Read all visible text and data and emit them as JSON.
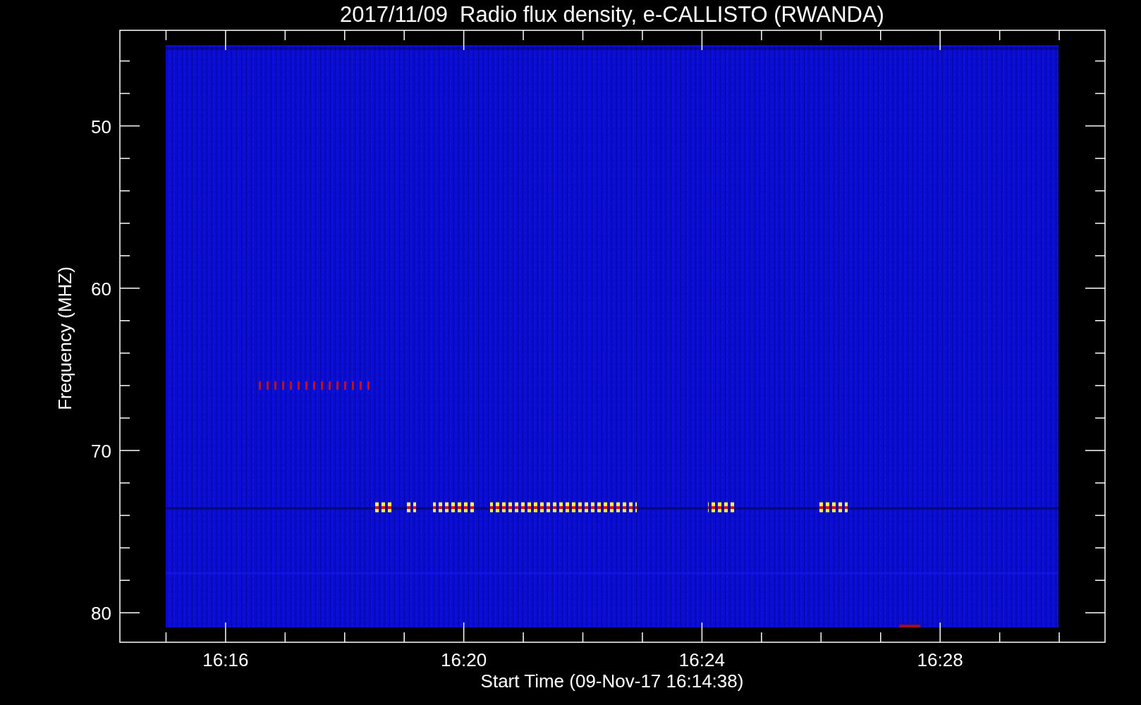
{
  "plot": {
    "title": "2017/11/09  Radio flux density, e-CALLISTO (RWANDA)",
    "xlabel": "Start Time (09-Nov-17 16:14:38)",
    "ylabel": "Frequency (MHZ)",
    "xtick_labels": [
      "16:16",
      "16:20",
      "16:24",
      "16:28"
    ],
    "ytick_labels": [
      "50",
      "60",
      "70",
      "80"
    ]
  }
}
